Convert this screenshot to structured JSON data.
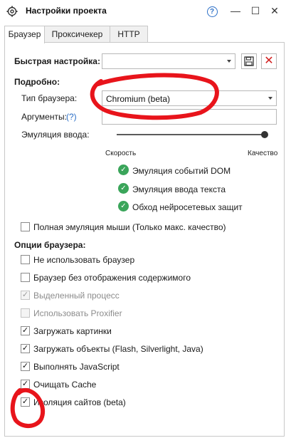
{
  "window": {
    "title": "Настройки проекта",
    "help_glyph": "?",
    "minimize_glyph": "—",
    "maximize_glyph": "☐",
    "close_glyph": "✕"
  },
  "tabs": [
    "Браузер",
    "Проксичекер",
    "HTTP"
  ],
  "active_tab": "Браузер",
  "quick_setup": {
    "label": "Быстрая настройка:",
    "value": ""
  },
  "details": {
    "header": "Подробно:",
    "browser_type_label": "Тип браузера:",
    "browser_type_value": "Chromium (beta)",
    "args_label": "Аргументы:",
    "args_help": "(?)",
    "args_value": "",
    "input_emulation_label": "Эмуляция ввода:",
    "slider_min_label": "Скорость",
    "slider_max_label": "Качество",
    "slider_value_fraction": 1.0
  },
  "emulation_features": [
    "Эмуляция событий DOM",
    "Эмуляция ввода текста",
    "Обход нейросетевых защит"
  ],
  "full_mouse_emulation": {
    "label": "Полная эмуляция мыши (Только макс. качество)",
    "checked": false
  },
  "browser_options": {
    "header": "Опции браузера:",
    "items": [
      {
        "label": "Не использовать браузер",
        "checked": false,
        "disabled": false
      },
      {
        "label": "Браузер без отображения содержимого",
        "checked": false,
        "disabled": false
      },
      {
        "label": "Выделенный процесс",
        "checked": true,
        "disabled": true
      },
      {
        "label": "Использовать Proxifier",
        "checked": false,
        "disabled": true
      },
      {
        "label": "Загружать картинки",
        "checked": true,
        "disabled": false
      },
      {
        "label": "Загружать объекты (Flash, Silverlight, Java)",
        "checked": true,
        "disabled": false
      },
      {
        "label": "Выполнять JavaScript",
        "checked": true,
        "disabled": false
      },
      {
        "label": "Очищать Cache",
        "checked": true,
        "disabled": false
      },
      {
        "label": "Изоляция сайтов (beta)",
        "checked": true,
        "disabled": false
      }
    ]
  },
  "colors": {
    "accent_blue": "#2b6fc7",
    "check_green": "#3aa55a",
    "annotation_red": "#e8141b",
    "delete_red": "#d21f1f"
  }
}
